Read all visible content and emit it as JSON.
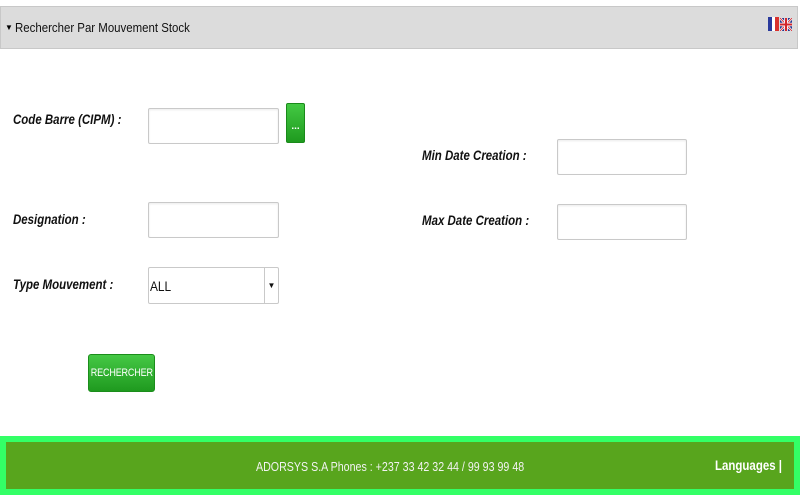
{
  "panel": {
    "toggle_icon": "triangle-down-icon",
    "title": "Rechercher Par Mouvement Stock"
  },
  "form": {
    "code_barre_label": "Code Barre (CIPM) :",
    "code_barre_value": "",
    "picker_label": "...",
    "designation_label": "Designation :",
    "designation_value": "",
    "type_mouvement_label": "Type Mouvement :",
    "type_mouvement_selected": "ALL",
    "min_date_label": "Min Date Creation :",
    "min_date_value": "",
    "max_date_label": "Max Date Creation :",
    "max_date_value": "",
    "search_button": "RECHERCHER"
  },
  "footer": {
    "contact": "ADORSYS S.A Phones : +237 33 42 32 44 / 99 93 99 48",
    "languages_label": "Languages |",
    "flags": [
      "flag-fr-icon",
      "flag-uk-icon"
    ]
  },
  "colors": {
    "button_green": "#2fb12f",
    "footer_green": "#58a51d",
    "footer_border": "#33ff66",
    "header_gray": "#dcdcdc"
  }
}
